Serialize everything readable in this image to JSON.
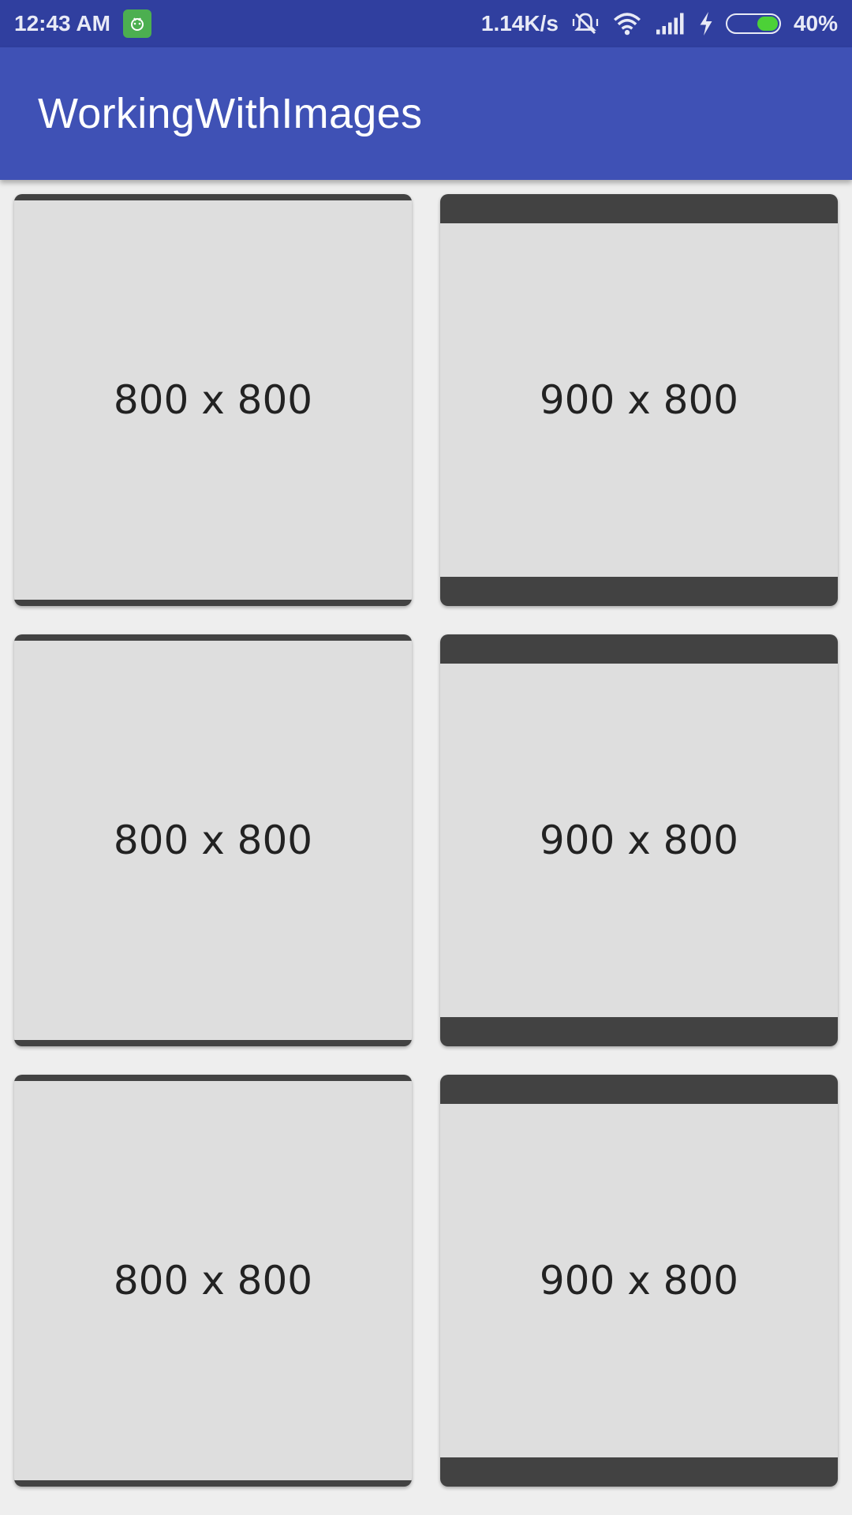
{
  "status_bar": {
    "time": "12:43 AM",
    "network_speed": "1.14K/s",
    "battery": "40%"
  },
  "app_bar": {
    "title": "WorkingWithImages"
  },
  "grid": {
    "items": [
      {
        "label": "800 x 800"
      },
      {
        "label": "900 x 800"
      },
      {
        "label": "800 x 800"
      },
      {
        "label": "900 x 800"
      },
      {
        "label": "800 x 800"
      },
      {
        "label": "900 x 800"
      }
    ]
  },
  "colors": {
    "primary": "#3f51b5",
    "primary_dark": "#303f9f",
    "background": "#eeeeee",
    "placeholder": "#dedede",
    "letterbox": "#424242"
  },
  "icons": [
    "android-notification-icon",
    "mute-vibrate-icon",
    "wifi-icon",
    "cellular-signal-icon",
    "charging-bolt-icon",
    "battery-icon"
  ]
}
